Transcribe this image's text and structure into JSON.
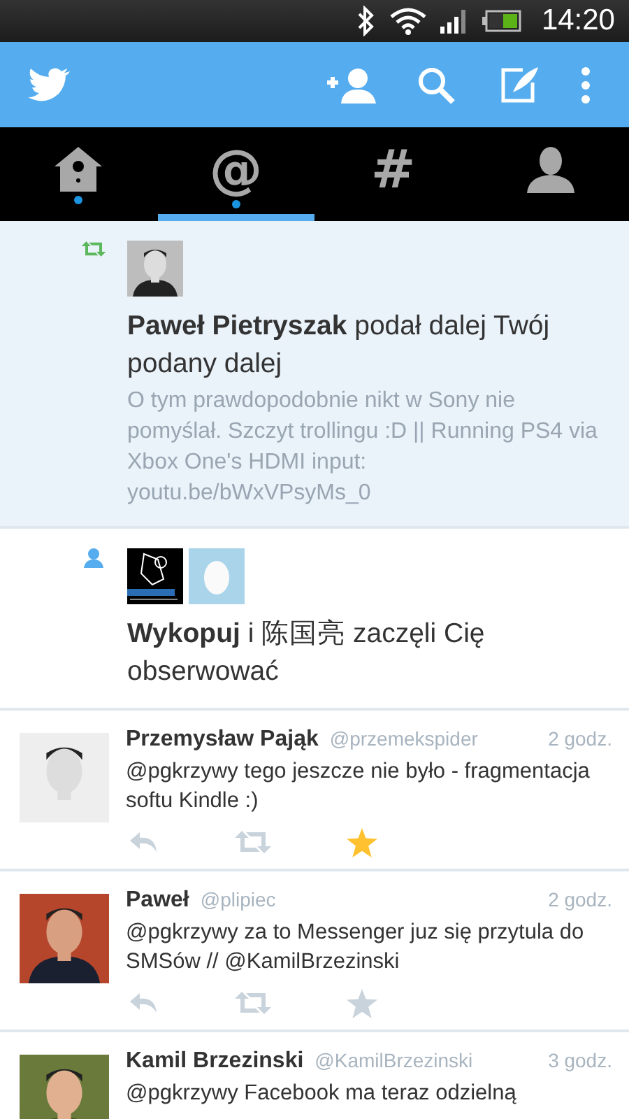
{
  "status_bar": {
    "time": "14:20"
  },
  "tabs": [
    {
      "kind": "home",
      "selected": false,
      "unread": true
    },
    {
      "kind": "text",
      "label": "@",
      "selected": true,
      "unread": true
    },
    {
      "kind": "text",
      "label": "#",
      "selected": false,
      "unread": false
    },
    {
      "kind": "profile",
      "selected": false,
      "unread": false
    }
  ],
  "feed": [
    {
      "kind": "retweet",
      "unread": true,
      "avatars": [
        {
          "kind": "picture"
        }
      ],
      "text": "**Paweł Pietryszak** podał dalej Twój podany dalej",
      "quote": "O tym prawdopodobnie nikt w Sony nie pomyślał. Szczyt trollingu :D || Running PS4 via Xbox One's HDMI input: youtu.be/bWxVPsyMs_0"
    },
    {
      "kind": "follow",
      "unread": false,
      "avatars": [
        {
          "kind": "picture"
        },
        {
          "kind": "egg"
        }
      ],
      "text": "**Wykopuj** i 陈国亮 zaczęli Cię obserwować"
    },
    {
      "kind": "tweet",
      "name": "Przemysław Pająk",
      "handle": "@przemekspider",
      "time": "2 godz.",
      "text": "@pgkrzywy tego jeszcze nie było - fragmentacja softu Kindle :)",
      "favorited": true
    },
    {
      "kind": "tweet",
      "name": "Paweł",
      "handle": "@plipiec",
      "time": "2 godz.",
      "text": "@pgkrzywy za to Messenger juz się przytula do SMSów // @KamilBrzezinski",
      "favorited": false
    },
    {
      "kind": "tweet",
      "name": "Kamil Brzezinski",
      "handle": "@KamilBrzezinski",
      "time": "3 godz.",
      "text": "@pgkrzywy Facebook ma teraz odzielną"
    }
  ]
}
